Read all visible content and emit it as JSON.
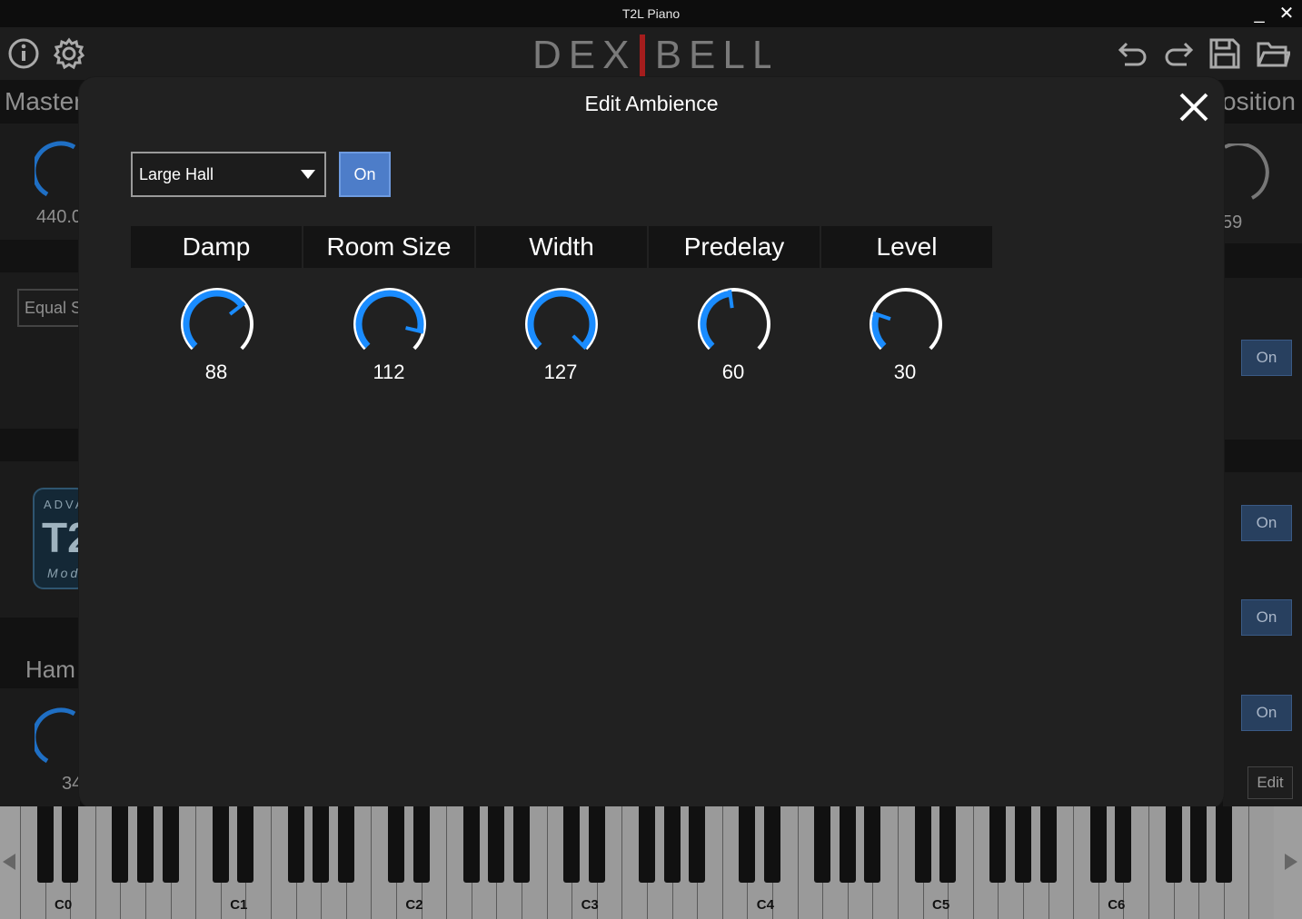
{
  "window": {
    "title": "T2L Piano",
    "minimize": "_",
    "close": "✕"
  },
  "toolbar": {
    "logo": "DEXIBELL",
    "icons": [
      "info-icon",
      "gear-icon",
      "undo-icon",
      "redo-icon",
      "save-icon",
      "folder-icon"
    ]
  },
  "background": {
    "master_label": "Master",
    "master_value": "440.0",
    "equal_label": "Equal S",
    "right_title": "osition",
    "right_value": "59",
    "logo_line1": "ADVA",
    "logo_big": "T2",
    "logo_line2": "Mod",
    "ham_label": "Ham",
    "ham_value": "34",
    "on_buttons": [
      "On",
      "On",
      "On",
      "On"
    ],
    "edit_label": "Edit"
  },
  "modal": {
    "title": "Edit Ambience",
    "preset": "Large Hall",
    "on_label": "On",
    "params": [
      {
        "name": "Damp",
        "value": 88
      },
      {
        "name": "Room Size",
        "value": 112
      },
      {
        "name": "Width",
        "value": 127
      },
      {
        "name": "Predelay",
        "value": 60
      },
      {
        "name": "Level",
        "value": 30
      }
    ],
    "max_value": 127
  },
  "keyboard": {
    "octave_labels": [
      "C0",
      "C1",
      "C2",
      "C3",
      "C4",
      "C5",
      "C6"
    ]
  },
  "colors": {
    "accent": "#1a8cff",
    "button_blue": "#4d7dc9"
  }
}
